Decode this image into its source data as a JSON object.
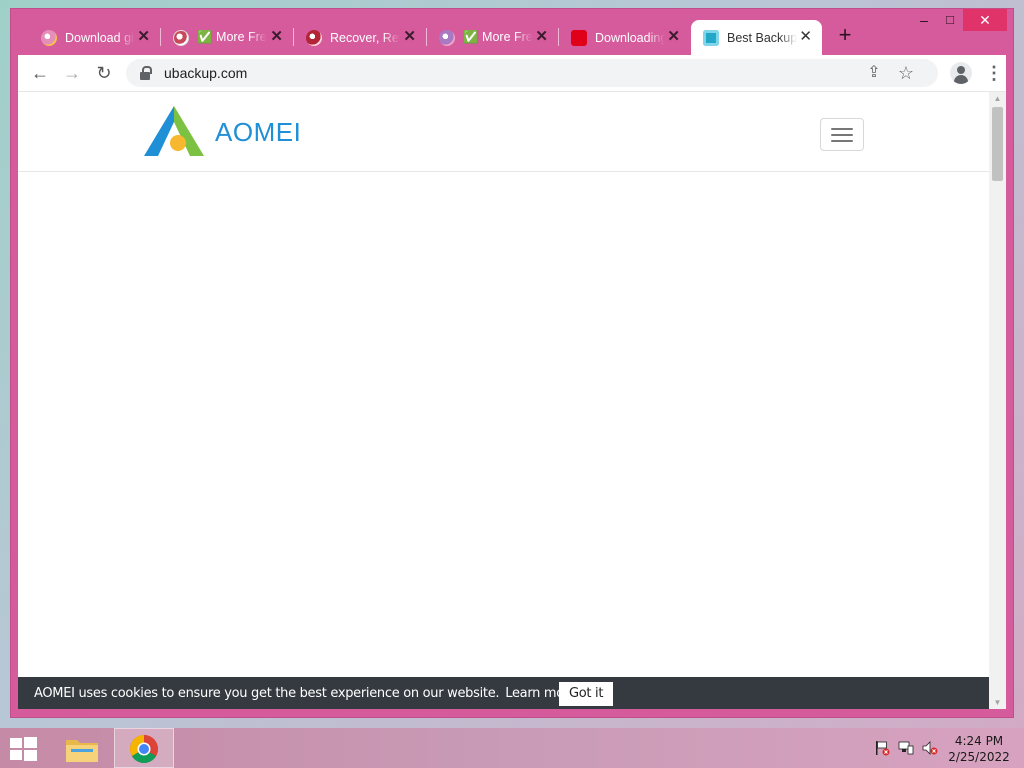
{
  "browser": {
    "tabs": [
      {
        "title": "Download gif",
        "favicon_color": "#e58fb8",
        "active": false
      },
      {
        "title": "✅ More Free",
        "favicon_color": "#c8495a",
        "active": false
      },
      {
        "title": "Recover, Retrieve",
        "favicon_color": "#b32436",
        "active": false
      },
      {
        "title": "✅ More Free",
        "favicon_color": "#a87ac4",
        "active": false
      },
      {
        "title": "Downloading",
        "favicon_color": "#e0001a",
        "active": false
      },
      {
        "title": "Best Backup",
        "favicon_color": "#22a7c9",
        "active": true
      }
    ],
    "new_tab": "+",
    "window_controls": {
      "minimize": "–",
      "maximize": "□",
      "close": "✕"
    },
    "tab_close": "✕",
    "nav": {
      "back": "←",
      "forward": "→",
      "reload": "↻"
    },
    "url": "ubackup.com",
    "icons": {
      "share": "⇪",
      "bookmark": "☆",
      "menu": "⋮"
    }
  },
  "page": {
    "brand": {
      "name": "AOMEI",
      "color": "#1f8fd6"
    },
    "cookie_banner": {
      "message": "AOMEI uses cookies to ensure you get the best experience on our website.",
      "learn_more": "Learn more",
      "accept": "Got it",
      "background": "#343a40"
    }
  },
  "taskbar": {
    "time": "4:24 PM",
    "date": "2/25/2022"
  }
}
